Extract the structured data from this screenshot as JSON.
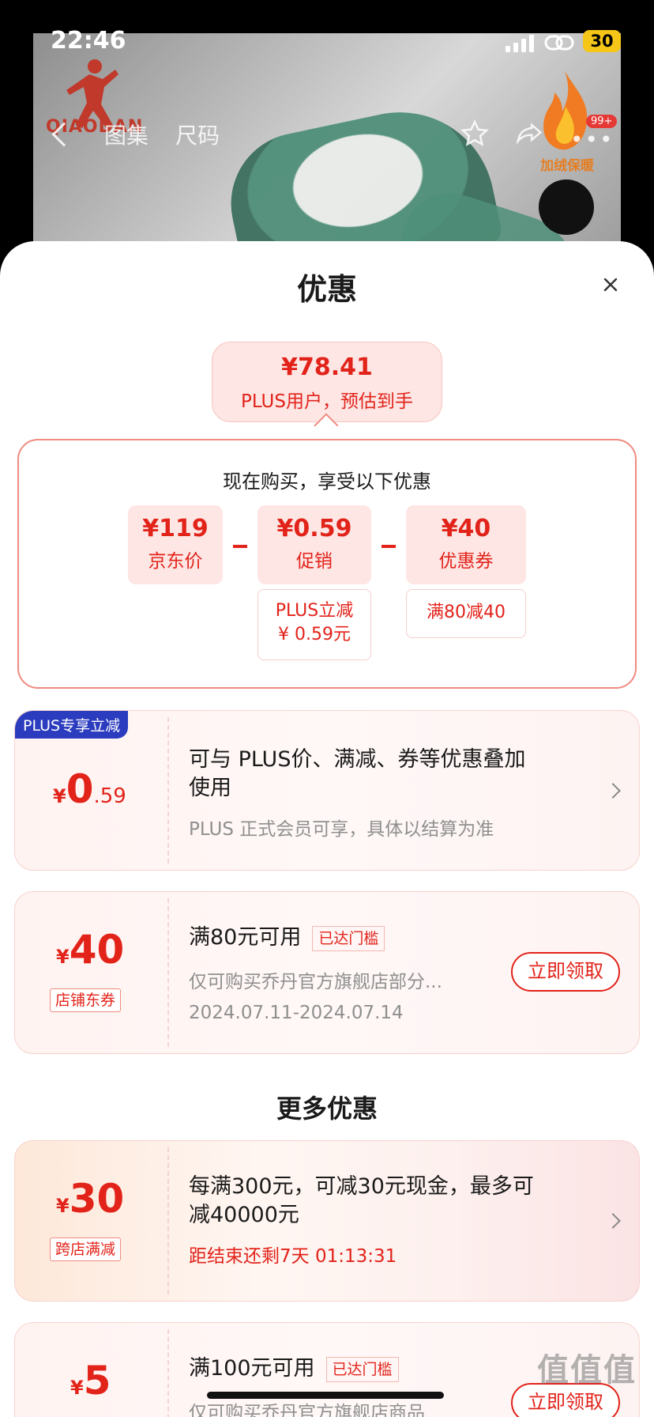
{
  "status_bar": {
    "time": "22:46",
    "battery": "30"
  },
  "background": {
    "brand_name": "QIAODAN",
    "nav": {
      "gallery_label": "图集",
      "size_label": "尺码"
    },
    "promo_badge": "加绒保暖",
    "cart_badge": "99+"
  },
  "sheet": {
    "title": "优惠",
    "estimate": {
      "price": "¥78.41",
      "caption": "PLUS用户，预估到手"
    },
    "calc": {
      "title": "现在购买，享受以下优惠",
      "items": [
        {
          "value": "¥119",
          "label": "京东价"
        },
        {
          "value": "¥0.59",
          "label": "促销",
          "detail_line1": "PLUS立减",
          "detail_line2": "¥ 0.59元"
        },
        {
          "value": "¥40",
          "label": "优惠券",
          "detail_line1": "满80减40"
        }
      ]
    },
    "plus_card": {
      "tag": "PLUS专享立减",
      "currency": "¥",
      "amount_int": "0",
      "amount_dec": ".59",
      "title_line1": "可与 PLUS价、满减、券等优惠叠加",
      "title_line2": "使用",
      "note": "PLUS 正式会员可享，具体以结算为准"
    },
    "store_coupon": {
      "currency": "¥",
      "amount": "40",
      "tag": "店铺东券",
      "title": "满80元可用",
      "reached": "已达门槛",
      "desc": "仅可购买乔丹官方旗舰店部分...",
      "date": "2024.07.11-2024.07.14",
      "button": "立即领取"
    },
    "more_title": "更多优惠",
    "cross_store": {
      "currency": "¥",
      "amount": "30",
      "tag": "跨店满减",
      "title_line1": "每满300元，可减30元现金，最多可",
      "title_line2": "减40000元",
      "countdown": "距结束还剩7天 01:13:31"
    },
    "coupon_5": {
      "currency": "¥",
      "amount": "5",
      "title": "满100元可用",
      "reached": "已达门槛",
      "desc": "仅可购买乔丹官方旗舰店商品",
      "button": "立即领取"
    }
  },
  "watermark": "值值值"
}
